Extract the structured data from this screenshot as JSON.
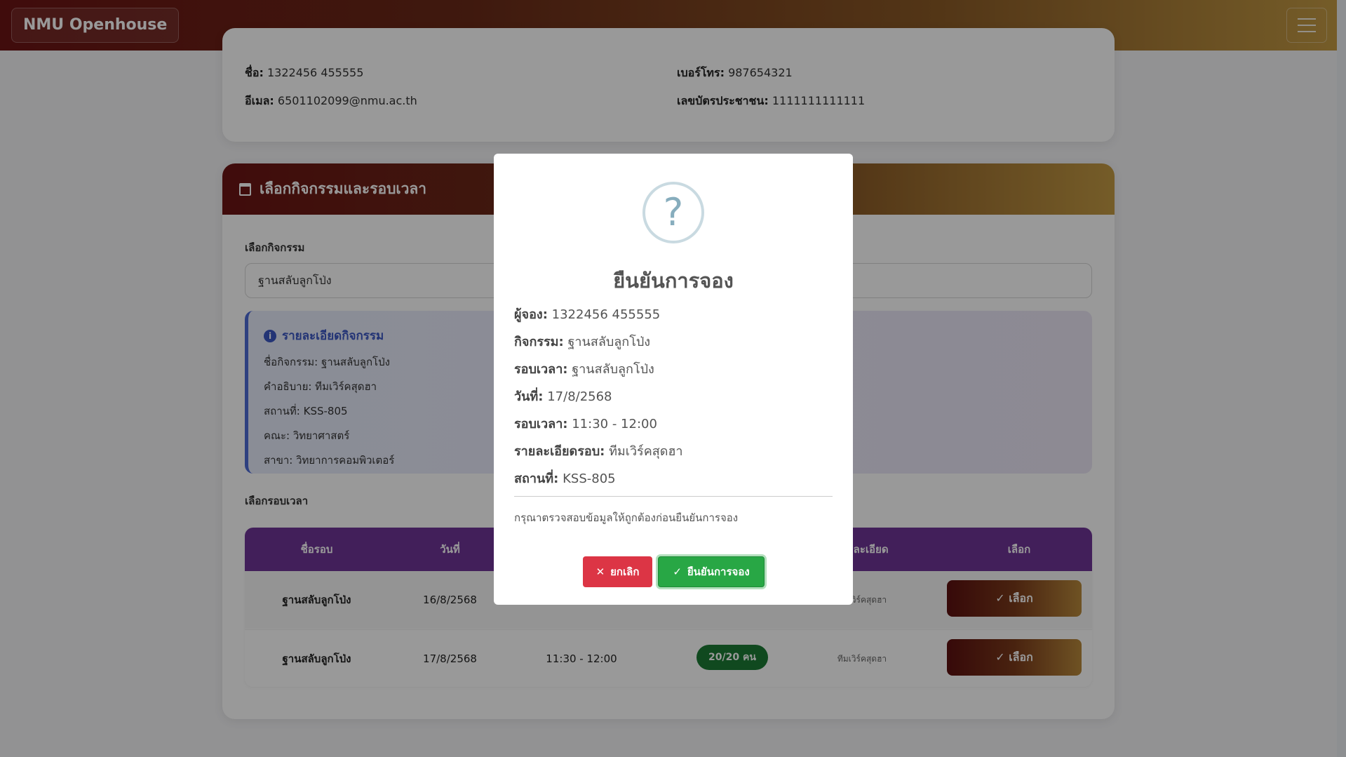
{
  "navbar": {
    "brand": "NMU Openhouse",
    "menu_icon": "hamburger-icon"
  },
  "profile": {
    "name_label": "ชื่อ:",
    "name_value": "1322456 455555",
    "email_label": "อีเมล:",
    "email_value": "6501102099@nmu.ac.th",
    "phone_label": "เบอร์โทร:",
    "phone_value": "987654321",
    "id_label": "เลขบัตรประชาชน:",
    "id_value": "1111111111111"
  },
  "select_card": {
    "header": "เลือกกิจกรรมและรอบเวลา",
    "header_icon": "calendar-icon",
    "activity_label": "เลือกกิจกรรม",
    "activity_value": "ฐานสลับลูกโป่ง",
    "details": {
      "title": "รายละเอียดกิจกรรม",
      "lines": [
        "ชื่อกิจกรรม: ฐานสลับลูกโป่ง",
        "คำอธิบาย: ทีมเวิร์คสุดฮา",
        "สถานที่: KSS-805",
        "คณะ: วิทยาศาสตร์",
        "สาขา: วิทยาการคอมพิวเตอร์"
      ]
    },
    "round_label": "เลือกรอบเวลา",
    "table": {
      "headers": [
        "ชื่อรอบ",
        "วันที่",
        "",
        "",
        "รายละเอียด",
        "เลือก"
      ],
      "rows": [
        {
          "name": "ฐานสลับลูกโป่ง",
          "date": "16/8/2568",
          "time": "",
          "seats": "",
          "detail": "ทีมเวิร์คสุดฮา",
          "action": "✓ เลือก"
        },
        {
          "name": "ฐานสลับลูกโป่ง",
          "date": "17/8/2568",
          "time": "11:30 - 12:00",
          "seats": "20/20 คน",
          "detail": "ทีมเวิร์คสุดฮา",
          "action": "✓ เลือก"
        }
      ]
    }
  },
  "modal": {
    "icon": "question-icon",
    "title": "ยืนยันการจอง",
    "rows": [
      {
        "label": "ผู้จอง:",
        "value": "1322456 455555"
      },
      {
        "label": "กิจกรรม:",
        "value": "ฐานสลับลูกโป่ง"
      },
      {
        "label": "รอบเวลา:",
        "value": "ฐานสลับลูกโป่ง"
      },
      {
        "label": "วันที่:",
        "value": "17/8/2568"
      },
      {
        "label": "รอบเวลา:",
        "value": "11:30 - 12:00"
      },
      {
        "label": "รายละเอียดรอบ:",
        "value": "ทีมเวิร์คสุดฮา"
      },
      {
        "label": "สถานที่:",
        "value": "KSS-805"
      }
    ],
    "note": "กรุณาตรวจสอบข้อมูลให้ถูกต้องก่อนยืนยันการจอง",
    "cancel_label": "ยกเลิก",
    "confirm_label": "ยืนยันการจอง"
  }
}
